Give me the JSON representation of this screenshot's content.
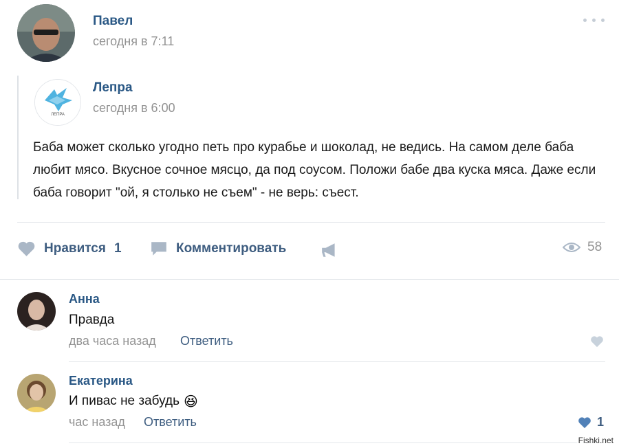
{
  "post": {
    "author": "Павел",
    "time": "сегодня в 7:11",
    "repost": {
      "author": "Лепра",
      "time": "сегодня в 6:00",
      "logo_text": "ЛЕПРА",
      "text": "Баба может сколько угодно петь про курабье и шоколад, не ведись. На самом деле баба любит мясо. Вкусное сочное мясцо, да под соусом. Положи бабе два куска мяса. Даже если баба говорит \"ой, я столько не съем\" - не верь: съест."
    },
    "actions": {
      "like_label": "Нравится",
      "like_count": "1",
      "comment_label": "Комментировать",
      "views": "58"
    }
  },
  "comments": [
    {
      "author": "Анна",
      "text": "Правда",
      "time": "два часа назад",
      "reply": "Ответить",
      "likes": ""
    },
    {
      "author": "Екатерина",
      "text": "И пивас не забудь",
      "emoji": "😆",
      "time": "час назад",
      "reply": "Ответить",
      "likes": "1"
    }
  ],
  "watermark": "Fishki.net",
  "colors": {
    "link": "#2a5885",
    "muted": "#939393",
    "action": "#3e5d80",
    "icon": "#aab7c6"
  }
}
